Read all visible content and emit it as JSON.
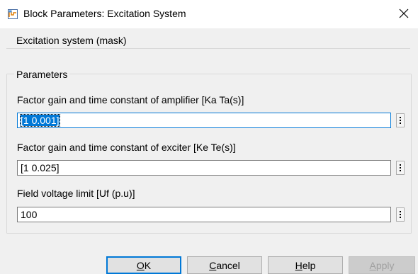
{
  "window": {
    "title": "Block Parameters: Excitation System",
    "icon": "simulink-block-icon",
    "close_icon": "close-icon"
  },
  "description": {
    "legend": "Excitation system (mask)"
  },
  "parameters": {
    "legend": "Parameters",
    "fields": [
      {
        "label": "Factor gain and time constant of amplifier [Ka Ta(s)]",
        "value": "[1 0.001]",
        "selected": true
      },
      {
        "label": "Factor gain and time constant of exciter [Ke Te(s)]",
        "value": "[1 0.025]",
        "selected": false
      },
      {
        "label": "Field voltage limit [Uf (p.u)]",
        "value": "100",
        "selected": false
      }
    ],
    "more_icon": "vertical-ellipsis-icon"
  },
  "buttons": {
    "ok": {
      "mnemonic": "O",
      "rest": "K"
    },
    "cancel": {
      "mnemonic": "C",
      "rest": "ancel"
    },
    "help": {
      "mnemonic": "H",
      "rest": "elp"
    },
    "apply": {
      "mnemonic": "A",
      "rest": "pply"
    }
  },
  "colors": {
    "accent": "#0078d7",
    "background": "#f0f0f0"
  }
}
